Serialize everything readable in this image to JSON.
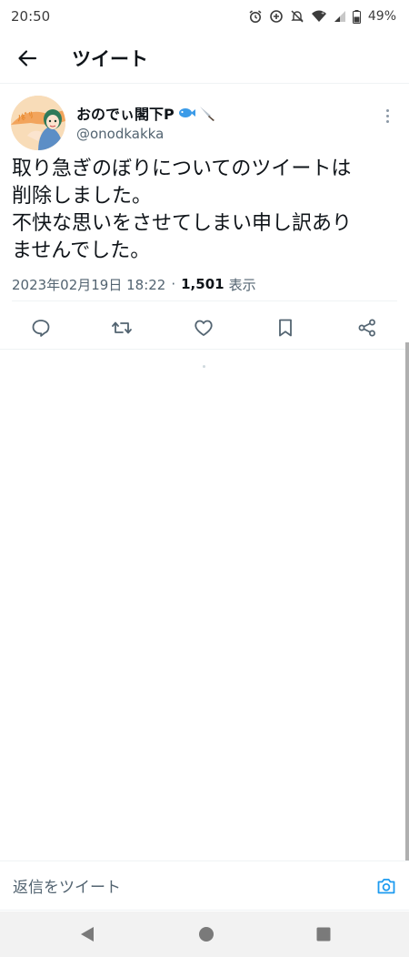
{
  "status_bar": {
    "time": "20:50",
    "battery": "49%",
    "icons": [
      "alarm-icon",
      "data-saver-icon",
      "mute-icon",
      "wifi-icon",
      "signal-icon",
      "battery-icon"
    ]
  },
  "header": {
    "title": "ツイート",
    "back_icon": "arrow-left-icon"
  },
  "tweet": {
    "author": {
      "name": "おのでぃ閣下P",
      "emojis": [
        "fish-emoji",
        "knife-emoji"
      ],
      "handle": "@onodkakka"
    },
    "text_lines": [
      "取り急ぎのぼりについてのツイートは",
      "削除しました。",
      "不快な思いをさせてしまい申し訳あり",
      "ませんでした。"
    ],
    "timestamp": "2023年02月19日 18:22",
    "separator": "·",
    "views_count": "1,501",
    "views_label": "表示",
    "actions": [
      "reply-icon",
      "retweet-icon",
      "like-icon",
      "bookmark-icon",
      "share-icon"
    ]
  },
  "reply_bar": {
    "placeholder": "返信をツイート",
    "camera_icon": "camera-icon"
  },
  "nav_bar": {
    "buttons": [
      "back-triangle-icon",
      "home-circle-icon",
      "recents-square-icon"
    ]
  },
  "colors": {
    "accent": "#1d9bf0",
    "text_primary": "#0f1419",
    "text_secondary": "#536471",
    "divider": "#eff3f4"
  }
}
